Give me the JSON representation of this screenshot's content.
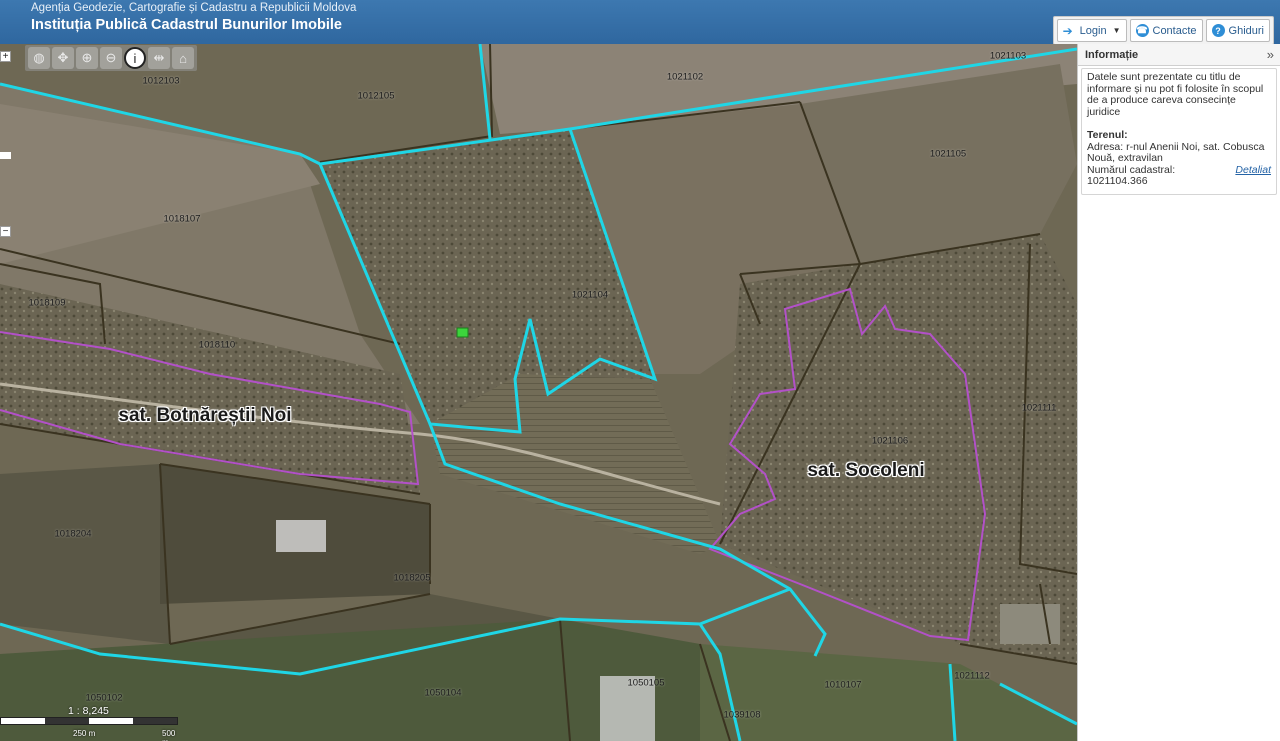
{
  "header": {
    "agency": "Agenția Geodezie, Cartografie și Cadastru a Republicii Moldova",
    "institution": "Instituția Publică Cadastrul Bunurilor Imobile",
    "buttons": {
      "login": "Login",
      "contacts": "Contacte",
      "guides": "Ghiduri"
    }
  },
  "panel": {
    "title": "Informație",
    "disclaimer": "Datele sunt prezentate cu titlu de informare și nu pot fi folosite în scopul de a produce careva consecințe juridice",
    "parcel_heading": "Terenul:",
    "address": "Adresa: r-nul Anenii Noi, sat. Cobusca Nouă, extravilan",
    "cadastral": "Numărul cadastral: 1021104.366",
    "detail_link": "Detaliat"
  },
  "map": {
    "zoom_in": "+",
    "zoom_out": "−",
    "scale_label": "1 : 8,245",
    "scale_ticks": [
      "250 m",
      "500 m"
    ],
    "parcels": [
      "1012103",
      "1021102",
      "1021103",
      "1012105",
      "1021105",
      "1018107",
      "1021104",
      "1018109",
      "1018110",
      "1021111",
      "1021106",
      "1018204",
      "1018205",
      "1050102",
      "1050104",
      "1050105",
      "1010107",
      "1039108",
      "1021112"
    ],
    "villages": [
      "sat. Botnăreștii Noi",
      "sat. Socoleni"
    ],
    "colors": {
      "boundary_cyan": "#1fd6e6",
      "village_purple": "#b251c8",
      "parcel_brown": "#3a3320",
      "selected": "#3cd43c"
    }
  }
}
